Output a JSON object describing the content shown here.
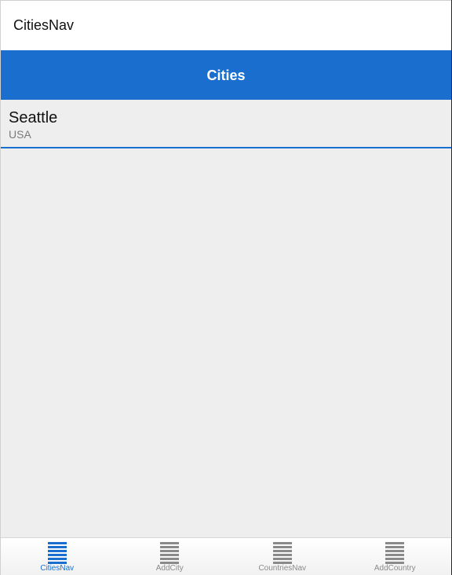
{
  "window": {
    "title": "CitiesNav"
  },
  "nav": {
    "title": "Cities"
  },
  "cities": [
    {
      "name": "Seattle",
      "country": "USA"
    }
  ],
  "tabs": [
    {
      "label": "CitiesNav",
      "icon": "list-icon",
      "active": true
    },
    {
      "label": "AddCity",
      "icon": "list-icon",
      "active": false
    },
    {
      "label": "CountriesNav",
      "icon": "list-icon",
      "active": false
    },
    {
      "label": "AddCountry",
      "icon": "list-icon",
      "active": false
    }
  ],
  "colors": {
    "accent": "#1a6fce",
    "inactive": "#8a8a8a",
    "background": "#eeeeee"
  }
}
